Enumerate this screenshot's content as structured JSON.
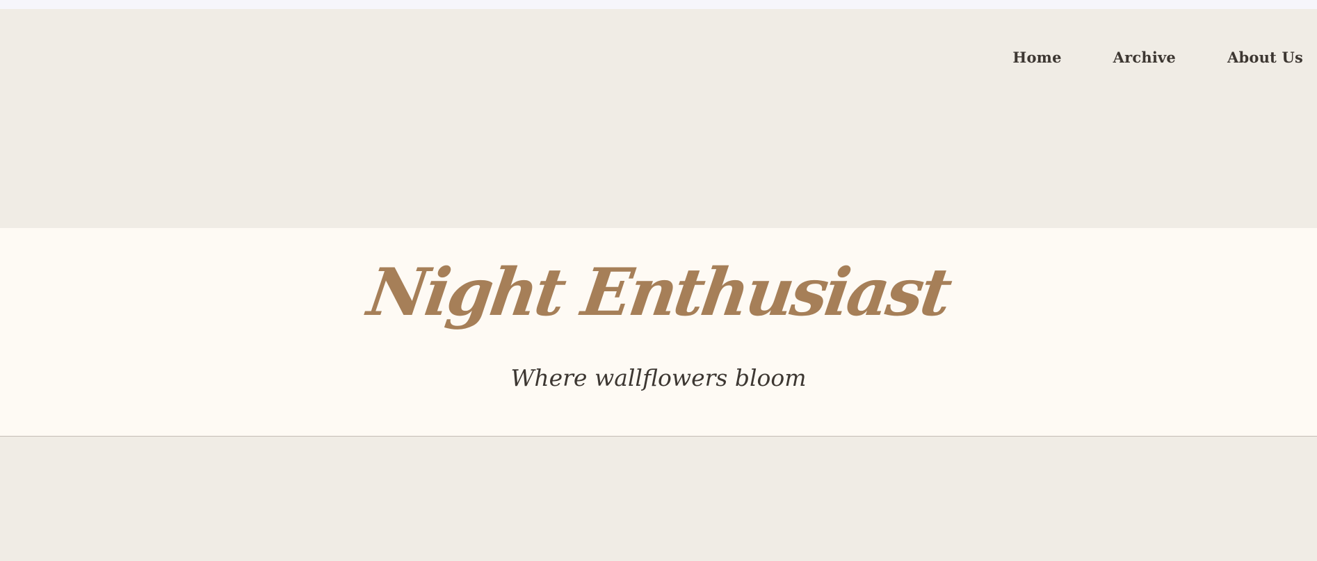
{
  "nav": {
    "items": [
      {
        "label": "Home"
      },
      {
        "label": "Archive"
      },
      {
        "label": "About Us"
      }
    ]
  },
  "banner": {
    "title": "Night Enthusiast",
    "tagline": "Where wallflowers bloom"
  },
  "colors": {
    "header_background": "#f0ece5",
    "banner_background": "#fefaf4",
    "title_accent": "#a67f58",
    "text": "#3d3732"
  }
}
